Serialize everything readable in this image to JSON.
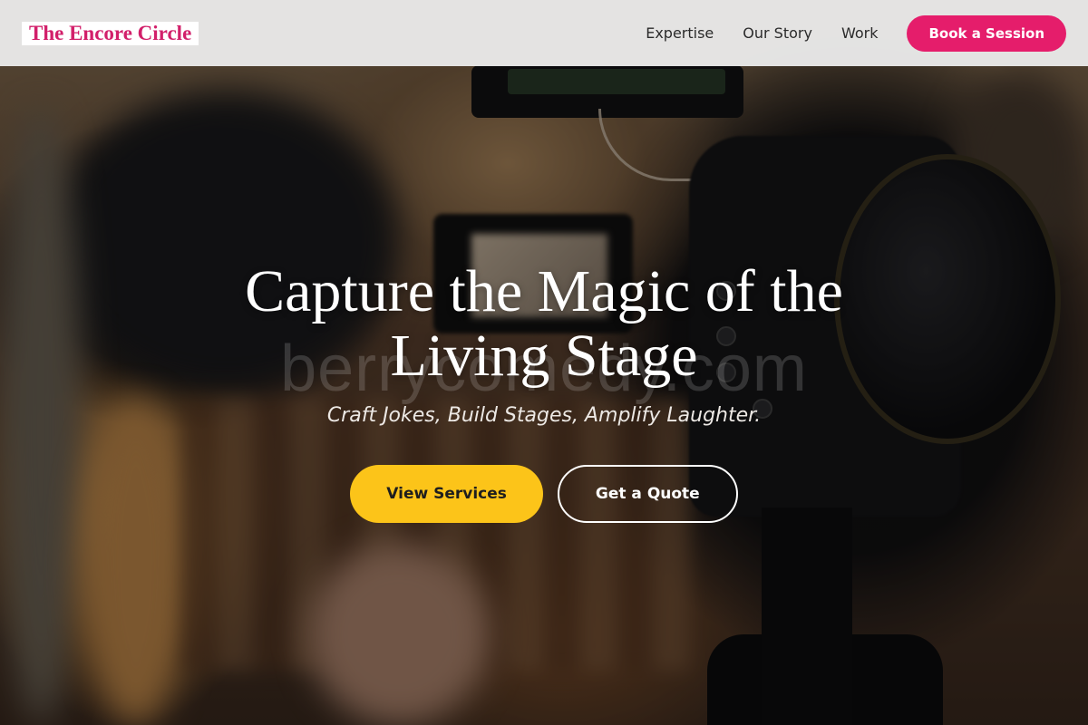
{
  "header": {
    "logo_text": "The Encore Circle",
    "nav": {
      "links": [
        "Expertise",
        "Our Story",
        "Work"
      ],
      "cta_label": "Book a Session"
    }
  },
  "hero": {
    "title": "Capture the Magic of the Living Stage",
    "subtitle": "Craft Jokes, Build Stages, Amplify Laughter.",
    "primary_button": "View Services",
    "secondary_button": "Get a Quote",
    "watermark": "berrycomedy.com",
    "background_image": "blurred video camera in a studio"
  },
  "colors": {
    "brand": "#d21f6a",
    "cta": "#e51d6b",
    "primary_button": "#fcc419",
    "header_bg": "#ececec"
  }
}
